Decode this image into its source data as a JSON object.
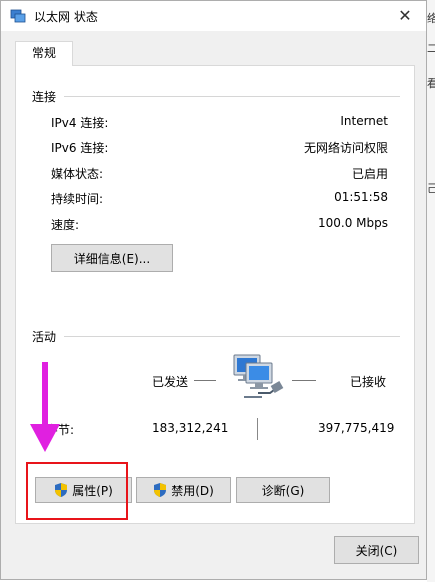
{
  "window": {
    "title": "以太网 状态",
    "close": "✕"
  },
  "tab": {
    "label": "常规"
  },
  "connection": {
    "heading": "连接",
    "rows": [
      {
        "label": "IPv4 连接:",
        "value": "Internet"
      },
      {
        "label": "IPv6 连接:",
        "value": "无网络访问权限"
      },
      {
        "label": "媒体状态:",
        "value": "已启用"
      },
      {
        "label": "持续时间:",
        "value": "01:51:58"
      },
      {
        "label": "速度:",
        "value": "100.0 Mbps"
      }
    ],
    "details_button": "详细信息(E)..."
  },
  "activity": {
    "heading": "活动",
    "sent_label": "已发送",
    "received_label": "已接收",
    "bytes_label": "字节:",
    "bytes_sent": "183,312,241",
    "bytes_received": "397,775,419"
  },
  "buttons": {
    "properties": "属性(P)",
    "disable": "禁用(D)",
    "diagnose": "诊断(G)",
    "close": "关闭(C)"
  },
  "colors": {
    "highlight": "#e8141a",
    "arrow": "#e020e0",
    "shield_blue": "#2d6cc0",
    "shield_yellow": "#f3c200"
  }
}
